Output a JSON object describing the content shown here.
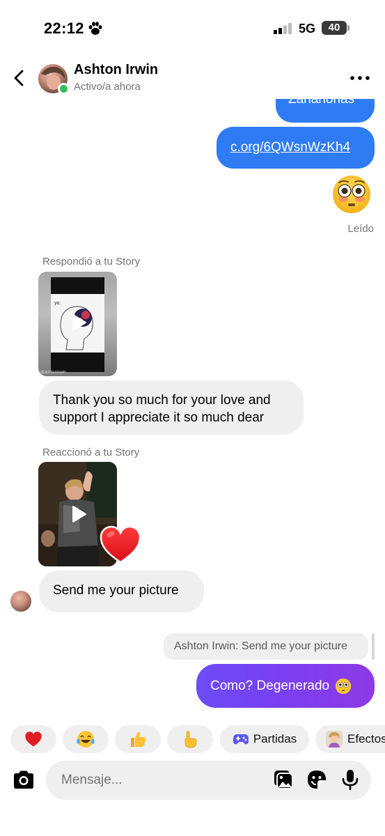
{
  "status_bar": {
    "time": "22:12",
    "network": "5G",
    "battery": "40",
    "paw_icon": "paw-icon",
    "signal_icon": "signal-icon"
  },
  "header": {
    "back_icon": "chevron-left-icon",
    "contact_name": "Ashton Irwin",
    "contact_status": "Activo/a ahora",
    "more_icon": "more-horizontal-icon",
    "online_color": "#2fc15b"
  },
  "messages": {
    "partial_outgoing": "Zanahorias",
    "link_message": "c.org/6QWsnWzKh4",
    "flushed_emoji_icon": "flushed-face-icon",
    "seen_label": "Leído",
    "story_reply_label": "Respondió a tu Story",
    "story_1_text": "yo:",
    "story_1_caption": "@ashtonirwin",
    "thanks_message": "Thank you so much for your love and support I appreciate it so much dear",
    "story_react_label": "Reaccionó a tu Story",
    "heart_reaction_icon": "red-heart-icon",
    "send_message": "Send me your picture",
    "reply_quote": "Ashton Irwin: Send me your picture",
    "como_message": "Como? Degenerado"
  },
  "quick_reactions": [
    {
      "icon": "red-heart-icon"
    },
    {
      "icon": "tears-of-joy-icon"
    },
    {
      "icon": "thumbs-up-icon"
    },
    {
      "icon": "pointing-hand-icon"
    },
    {
      "icon": "game-controller-icon",
      "label": "Partidas"
    },
    {
      "icon": "effects-avatar-icon",
      "label": "Efectos"
    }
  ],
  "composer": {
    "placeholder": "Mensaje...",
    "camera_icon": "camera-icon",
    "gallery_icon": "gallery-icon",
    "sticker_icon": "sticker-icon",
    "mic_icon": "microphone-icon"
  },
  "colors": {
    "outgoing_bubble": "#2f7bf3",
    "incoming_bubble": "#efefef",
    "gradient_bubble_start": "#6c4cf6",
    "gradient_bubble_end": "#8e3ae6"
  }
}
